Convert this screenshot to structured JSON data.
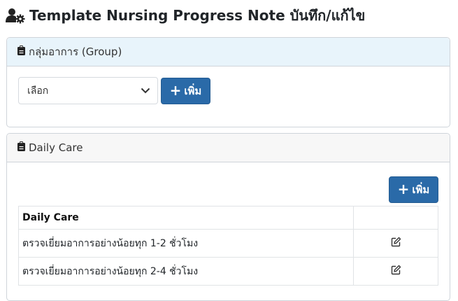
{
  "page": {
    "title": "Template Nursing Progress Note บันทึก/แก้ไข",
    "title_icon": "user-gear-icon"
  },
  "group_card": {
    "header": "กลุ่มอาการ (Group)",
    "header_icon": "clipboard-icon",
    "select_value": "เลือก",
    "add_button_label": "เพิ่ม"
  },
  "daily_card": {
    "header": "Daily Care",
    "header_icon": "clipboard-icon",
    "add_button_label": "เพิ่ม",
    "table": {
      "header": "Daily Care",
      "rows": [
        {
          "text": "ตรวจเยี่ยมอาการอย่างน้อยทุก 1-2 ชั่วโมง",
          "action_icon": "edit-icon"
        },
        {
          "text": "ตรวจเยี่ยมอาการอย่างน้อยทุก 2-4 ชั่วโมง",
          "action_icon": "edit-icon"
        }
      ]
    }
  },
  "colors": {
    "primary": "#2a6aa8",
    "group_header_bg": "#e8f4fb",
    "card_header_bg": "#f7f7f7",
    "border": "#cfd4da"
  }
}
